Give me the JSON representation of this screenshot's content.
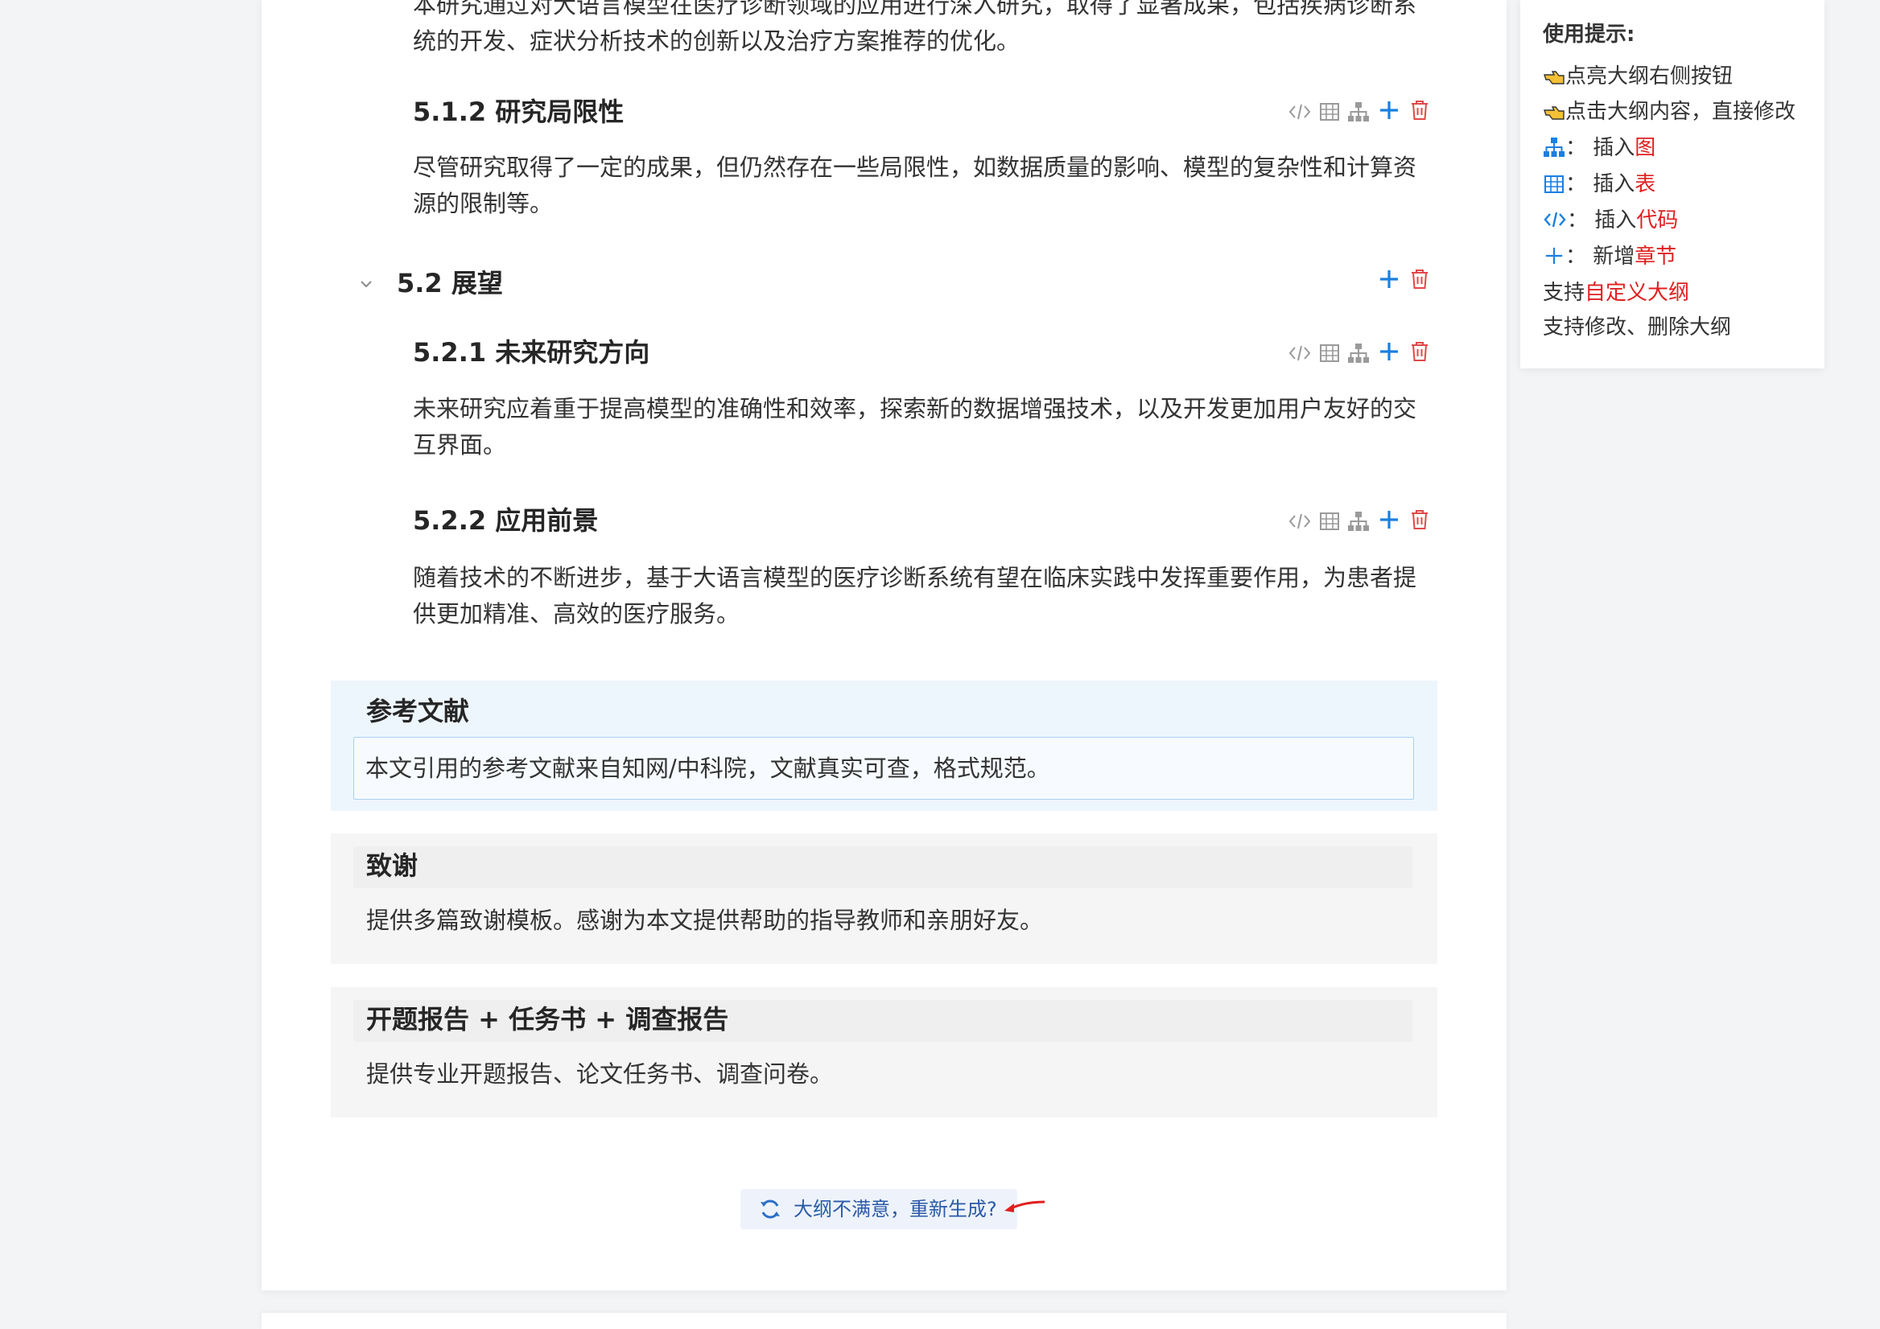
{
  "outline": {
    "intro_partial": "本研究通过对大语言模型在医疗诊断领域的应用进行深入研究，取得了显著成果，包括疾病诊断系",
    "intro_tail": "统的开发、症状分析技术的创新以及治疗方案推荐的优化。",
    "s512": {
      "title": "5.1.2 研究局限性",
      "body_l1": "尽管研究取得了一定的成果，但仍然存在一些局限性，如数据质量的影响、模型的复杂性和计算资",
      "body_l2": "源的限制等。"
    },
    "s52": {
      "title": "5.2 展望"
    },
    "s521": {
      "title": "5.2.1 未来研究方向",
      "body_l1": "未来研究应着重于提高模型的准确性和效率，探索新的数据增强技术，以及开发更加用户友好的交",
      "body_l2": "互界面。"
    },
    "s522": {
      "title": "5.2.2 应用前景",
      "body_l1": "随着技术的不断进步，基于大语言模型的医疗诊断系统有望在临床实践中发挥重要作用，为患者提",
      "body_l2": "供更加精准、高效的医疗服务。"
    }
  },
  "references": {
    "title": "参考文献",
    "text": "本文引用的参考文献来自知网/中科院，文献真实可查，格式规范。"
  },
  "thanks": {
    "title": "致谢",
    "text": "提供多篇致谢模板。感谢为本文提供帮助的指导教师和亲朋好友。"
  },
  "reports": {
    "title": "开题报告 + 任务书 + 调查报告",
    "text": "提供专业开题报告、论文任务书、调查问卷。"
  },
  "regenerate": {
    "label": "大纲不满意，重新生成?"
  },
  "tips": {
    "title": "使用提示:",
    "hint1": "点亮大纲右侧按钮",
    "hint2": "点击大纲内容，直接修改",
    "fig_prefix": "： 插入",
    "fig_red": "图",
    "table_prefix": "： 插入",
    "table_red": "表",
    "code_prefix": "： 插入",
    "code_red": "代码",
    "section_prefix": "： 新增",
    "section_red": "章节",
    "custom_prefix": "支持",
    "custom_red": "自定义大纲",
    "edit": "支持修改、删除大纲"
  },
  "colors": {
    "accent": "#1a7fe0",
    "danger": "#e04848",
    "grey_icon": "#9a9a9a",
    "ref_bg": "#eef6fd",
    "ref_border": "#a9d0f0"
  }
}
